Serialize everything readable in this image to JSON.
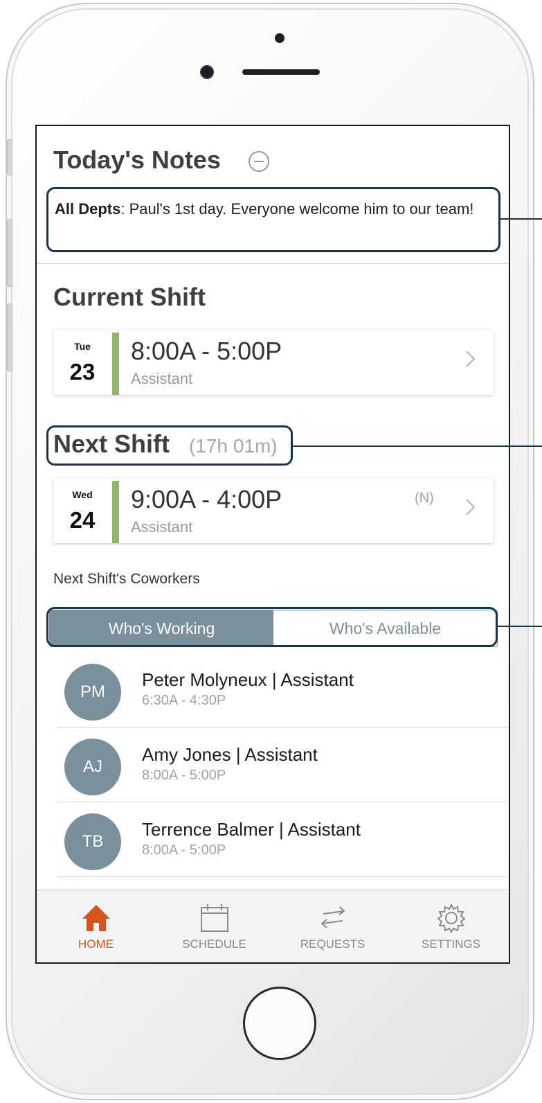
{
  "notes": {
    "title": "Today's Notes",
    "dept": "All Depts",
    "text": ": Paul's 1st day. Everyone welcome him to our team!"
  },
  "current_shift": {
    "title": "Current Shift",
    "dow": "Tue",
    "day": "23",
    "time": "8:00A - 5:00P",
    "role": "Assistant"
  },
  "next_shift": {
    "title": "Next Shift",
    "countdown": "(17h 01m)",
    "dow": "Wed",
    "day": "24",
    "time": "9:00A - 4:00P",
    "role": "Assistant",
    "flag": "(N)"
  },
  "coworkers": {
    "label": "Next Shift's Coworkers",
    "tabs": [
      "Who's Working",
      "Who's Available"
    ],
    "items": [
      {
        "initials": "PM",
        "name": "Peter Molyneux | Assistant",
        "time": "6:30A - 4:30P"
      },
      {
        "initials": "AJ",
        "name": "Amy Jones | Assistant",
        "time": "8:00A - 5:00P"
      },
      {
        "initials": "TB",
        "name": "Terrence Balmer | Assistant",
        "time": "8:00A - 5:00P"
      }
    ]
  },
  "tabbar": {
    "items": [
      {
        "label": "HOME",
        "icon": "home-icon"
      },
      {
        "label": "SCHEDULE",
        "icon": "calendar-icon"
      },
      {
        "label": "REQUESTS",
        "icon": "swap-arrows-icon"
      },
      {
        "label": "SETTINGS",
        "icon": "gear-icon"
      }
    ]
  },
  "colors": {
    "accent": "#d9531e",
    "slate": "#7a909c",
    "shift_bar": "#8fb46a",
    "callout": "#14344f"
  }
}
